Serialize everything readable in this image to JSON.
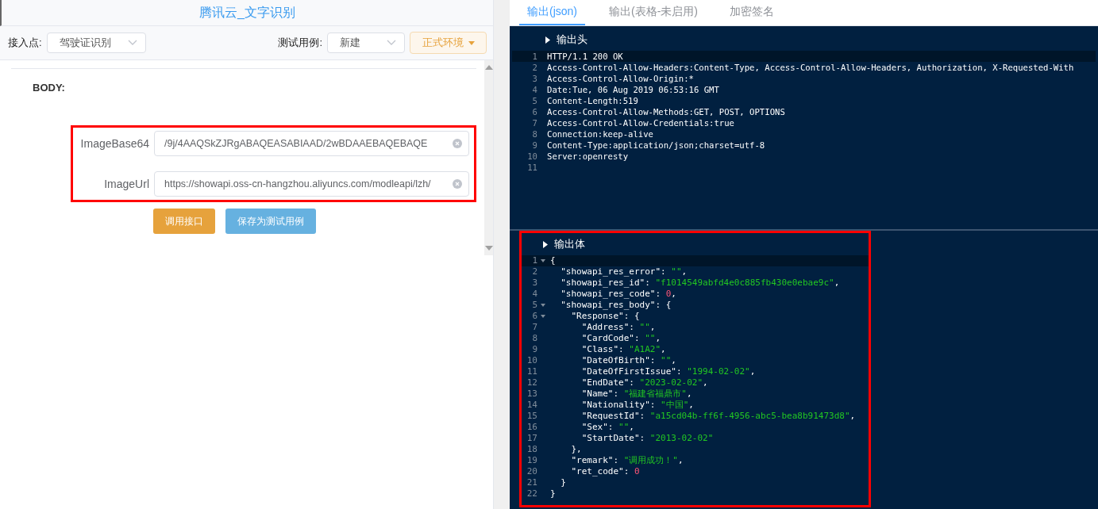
{
  "left": {
    "title": "腾讯云_文字识别",
    "toolbar": {
      "endpoint_label": "接入点:",
      "endpoint_value": "驾驶证识别",
      "case_label": "测试用例:",
      "case_value": "新建",
      "env_button": "正式环境"
    },
    "section_label": "BODY:",
    "fields_highlighted": true,
    "fields": [
      {
        "label": "ImageBase64",
        "value": "/9j/4AAQSkZJRgABAQEASABIAAD/2wBDAAEBAQEBAQE"
      },
      {
        "label": "ImageUrl",
        "value": "https://showapi.oss-cn-hangzhou.aliyuncs.com/modleapi/lzh/"
      }
    ],
    "buttons": [
      {
        "label": "调用接口",
        "kind": "primary"
      },
      {
        "label": "保存为测试用例",
        "kind": "secondary"
      }
    ]
  },
  "right": {
    "tabs": [
      {
        "label": "输出(json)",
        "selected": true
      },
      {
        "label": "输出(表格-未启用)",
        "selected": false
      },
      {
        "label": "加密签名",
        "selected": false
      }
    ],
    "header": {
      "title": "输出头",
      "highlighted": false,
      "lines": [
        {
          "number": "1",
          "text": "HTTP/1.1 200 OK"
        },
        {
          "number": "2",
          "text": "Access-Control-Allow-Headers:Content-Type, Access-Control-Allow-Headers, Authorization, X-Requested-With"
        },
        {
          "number": "3",
          "text": "Access-Control-Allow-Origin:*"
        },
        {
          "number": "4",
          "text": "Date:Tue, 06 Aug 2019 06:53:16 GMT"
        },
        {
          "number": "5",
          "text": "Content-Length:519"
        },
        {
          "number": "6",
          "text": "Access-Control-Allow-Methods:GET, POST, OPTIONS"
        },
        {
          "number": "7",
          "text": "Access-Control-Allow-Credentials:true"
        },
        {
          "number": "8",
          "text": "Connection:keep-alive"
        },
        {
          "number": "9",
          "text": "Content-Type:application/json;charset=utf-8"
        },
        {
          "number": "10",
          "text": "Server:openresty"
        },
        {
          "number": "11"
        }
      ]
    },
    "body": {
      "title": "输出体",
      "highlighted": true,
      "lines": [
        {
          "number": "1",
          "foldable": true,
          "tokens": [
            {
              "kind": "punct",
              "text": "{"
            }
          ]
        },
        {
          "number": "2",
          "foldable": false,
          "tokens": [
            {
              "kind": "key",
              "text": "  \"showapi_res_error\""
            },
            {
              "kind": "punct",
              "text": ": "
            },
            {
              "kind": "str",
              "text": "\"\""
            },
            {
              "kind": "punct",
              "text": ","
            }
          ]
        },
        {
          "number": "3",
          "foldable": false,
          "tokens": [
            {
              "kind": "key",
              "text": "  \"showapi_res_id\""
            },
            {
              "kind": "punct",
              "text": ": "
            },
            {
              "kind": "str",
              "text": "\"f1014549abfd4e0c885fb430e0ebae9c\""
            },
            {
              "kind": "punct",
              "text": ","
            }
          ]
        },
        {
          "number": "4",
          "foldable": false,
          "tokens": [
            {
              "kind": "key",
              "text": "  \"showapi_res_code\""
            },
            {
              "kind": "punct",
              "text": ": "
            },
            {
              "kind": "num",
              "text": "0"
            },
            {
              "kind": "punct",
              "text": ","
            }
          ]
        },
        {
          "number": "5",
          "foldable": true,
          "tokens": [
            {
              "kind": "key",
              "text": "  \"showapi_res_body\""
            },
            {
              "kind": "punct",
              "text": ": {"
            }
          ]
        },
        {
          "number": "6",
          "foldable": true,
          "tokens": [
            {
              "kind": "key",
              "text": "    \"Response\""
            },
            {
              "kind": "punct",
              "text": ": {"
            }
          ]
        },
        {
          "number": "7",
          "foldable": false,
          "tokens": [
            {
              "kind": "key",
              "text": "      \"Address\""
            },
            {
              "kind": "punct",
              "text": ": "
            },
            {
              "kind": "str",
              "text": "\"\""
            },
            {
              "kind": "punct",
              "text": ","
            }
          ]
        },
        {
          "number": "8",
          "foldable": false,
          "tokens": [
            {
              "kind": "key",
              "text": "      \"CardCode\""
            },
            {
              "kind": "punct",
              "text": ": "
            },
            {
              "kind": "str",
              "text": "\"\""
            },
            {
              "kind": "punct",
              "text": ","
            }
          ]
        },
        {
          "number": "9",
          "foldable": false,
          "tokens": [
            {
              "kind": "key",
              "text": "      \"Class\""
            },
            {
              "kind": "punct",
              "text": ": "
            },
            {
              "kind": "str",
              "text": "\"A1A2\""
            },
            {
              "kind": "punct",
              "text": ","
            }
          ]
        },
        {
          "number": "10",
          "foldable": false,
          "tokens": [
            {
              "kind": "key",
              "text": "      \"DateOfBirth\""
            },
            {
              "kind": "punct",
              "text": ": "
            },
            {
              "kind": "str",
              "text": "\"\""
            },
            {
              "kind": "punct",
              "text": ","
            }
          ]
        },
        {
          "number": "11",
          "foldable": false,
          "tokens": [
            {
              "kind": "key",
              "text": "      \"DateOfFirstIssue\""
            },
            {
              "kind": "punct",
              "text": ": "
            },
            {
              "kind": "str",
              "text": "\"1994-02-02\""
            },
            {
              "kind": "punct",
              "text": ","
            }
          ]
        },
        {
          "number": "12",
          "foldable": false,
          "tokens": [
            {
              "kind": "key",
              "text": "      \"EndDate\""
            },
            {
              "kind": "punct",
              "text": ": "
            },
            {
              "kind": "str",
              "text": "\"2023-02-02\""
            },
            {
              "kind": "punct",
              "text": ","
            }
          ]
        },
        {
          "number": "13",
          "foldable": false,
          "tokens": [
            {
              "kind": "key",
              "text": "      \"Name\""
            },
            {
              "kind": "punct",
              "text": ": "
            },
            {
              "kind": "str",
              "text": "\"福建省福鼎市\""
            },
            {
              "kind": "punct",
              "text": ","
            }
          ]
        },
        {
          "number": "14",
          "foldable": false,
          "tokens": [
            {
              "kind": "key",
              "text": "      \"Nationality\""
            },
            {
              "kind": "punct",
              "text": ": "
            },
            {
              "kind": "str",
              "text": "\"中国\""
            },
            {
              "kind": "punct",
              "text": ","
            }
          ]
        },
        {
          "number": "15",
          "foldable": false,
          "tokens": [
            {
              "kind": "key",
              "text": "      \"RequestId\""
            },
            {
              "kind": "punct",
              "text": ": "
            },
            {
              "kind": "str",
              "text": "\"a15cd04b-ff6f-4956-abc5-bea8b91473d8\""
            },
            {
              "kind": "punct",
              "text": ","
            }
          ]
        },
        {
          "number": "16",
          "foldable": false,
          "tokens": [
            {
              "kind": "key",
              "text": "      \"Sex\""
            },
            {
              "kind": "punct",
              "text": ": "
            },
            {
              "kind": "str",
              "text": "\"\""
            },
            {
              "kind": "punct",
              "text": ","
            }
          ]
        },
        {
          "number": "17",
          "foldable": false,
          "tokens": [
            {
              "kind": "key",
              "text": "      \"StartDate\""
            },
            {
              "kind": "punct",
              "text": ": "
            },
            {
              "kind": "str",
              "text": "\"2013-02-02\""
            }
          ]
        },
        {
          "number": "18",
          "foldable": false,
          "tokens": [
            {
              "kind": "punct",
              "text": "    },"
            }
          ]
        },
        {
          "number": "19",
          "foldable": false,
          "tokens": [
            {
              "kind": "key",
              "text": "    \"remark\""
            },
            {
              "kind": "punct",
              "text": ": "
            },
            {
              "kind": "str",
              "text": "\"调用成功！\""
            },
            {
              "kind": "punct",
              "text": ","
            }
          ]
        },
        {
          "number": "20",
          "foldable": false,
          "tokens": [
            {
              "kind": "key",
              "text": "    \"ret_code\""
            },
            {
              "kind": "punct",
              "text": ": "
            },
            {
              "kind": "num",
              "text": "0"
            }
          ]
        },
        {
          "number": "21",
          "foldable": false,
          "tokens": [
            {
              "kind": "punct",
              "text": "  }"
            }
          ]
        },
        {
          "number": "22",
          "foldable": false,
          "tokens": [
            {
              "kind": "punct",
              "text": "}"
            }
          ]
        }
      ]
    }
  }
}
